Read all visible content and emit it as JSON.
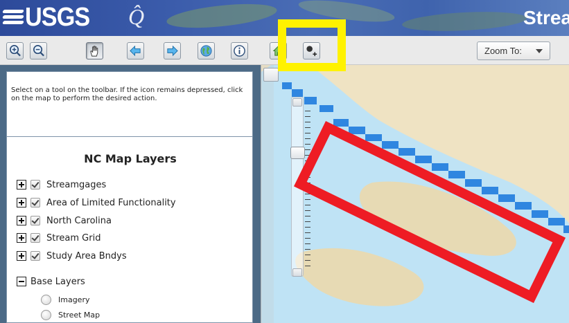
{
  "header": {
    "logo_text": "USGS",
    "app_title": "Strea"
  },
  "toolbar": {
    "tools": [
      {
        "name": "zoom-in",
        "icon": "zoom-in-icon"
      },
      {
        "name": "zoom-out",
        "icon": "zoom-out-icon"
      },
      {
        "name": "pan",
        "icon": "hand-icon",
        "pressed": true
      },
      {
        "name": "previous-extent",
        "icon": "arrow-left-icon"
      },
      {
        "name": "next-extent",
        "icon": "arrow-right-icon"
      },
      {
        "name": "full-extent",
        "icon": "globe-icon"
      },
      {
        "name": "identify",
        "icon": "info-icon"
      },
      {
        "name": "home",
        "icon": "house-icon"
      },
      {
        "name": "add-point",
        "icon": "add-point-icon"
      }
    ],
    "zoom_to_label": "Zoom To:"
  },
  "help": {
    "text": "Select on a tool on the toolbar. If the icon remains depressed, click on the map to perform the desired action."
  },
  "layers": {
    "title": "NC Map Layers",
    "items": [
      {
        "label": "Streamgages",
        "checked": true
      },
      {
        "label": "Area of Limited Functionality",
        "checked": true
      },
      {
        "label": "North Carolina",
        "checked": true
      },
      {
        "label": "Stream Grid",
        "checked": true
      },
      {
        "label": "Study Area Bndys",
        "checked": true
      }
    ],
    "base_layers_label": "Base Layers",
    "base_layers": [
      {
        "label": "Imagery"
      },
      {
        "label": "Street Map"
      }
    ]
  },
  "colors": {
    "highlight_yellow": "#fff200",
    "highlight_red": "#ee1c24",
    "water": "#bfe3f5",
    "stream_grid": "#2f86e0",
    "land": "#f0e4c4"
  }
}
